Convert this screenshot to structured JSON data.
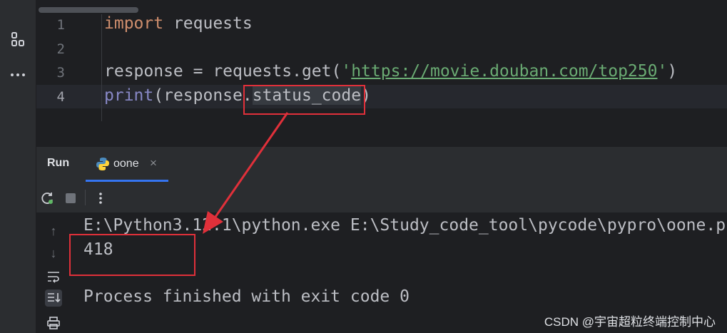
{
  "left_strip": {
    "tools": [
      "project-icon",
      "structure-icon",
      "more-icon"
    ]
  },
  "editor": {
    "lines": [
      {
        "num": "1",
        "kw": "import",
        "rest": " requests"
      },
      {
        "num": "2"
      },
      {
        "num": "3",
        "pre": "response = requests.get(",
        "quote1": "'",
        "url": "https://movie.douban.com/top250",
        "quote2": "'",
        "post": ")"
      },
      {
        "num": "4",
        "fn": "print",
        "paren1": "(response.",
        "attr": "status_code",
        "paren2": ")"
      }
    ]
  },
  "run_panel": {
    "title": "Run",
    "tab_label": "oone",
    "close_glyph": "×",
    "console_lines": [
      "E:\\Python3.12.1\\python.exe E:\\Study_code_tool\\pycode\\pypro\\oone.p",
      "418",
      "",
      "Process finished with exit code 0"
    ]
  },
  "watermark": "CSDN @宇宙超粒终端控制中心",
  "colors": {
    "annotation_red": "#e0303a",
    "tab_accent": "#3574f0"
  }
}
